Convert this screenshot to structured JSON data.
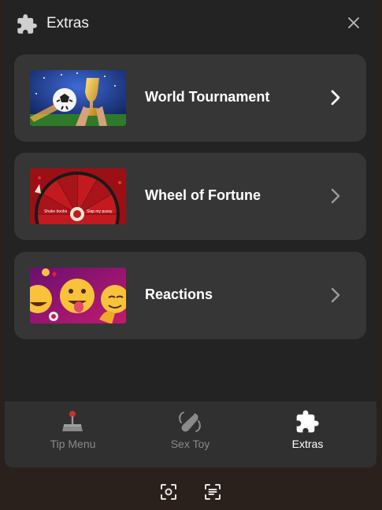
{
  "header": {
    "title": "Extras",
    "icon": "puzzle-icon",
    "close_icon": "close-icon"
  },
  "cards": [
    {
      "label": "World Tournament",
      "image": "soccer-trophy-thumbnail"
    },
    {
      "label": "Wheel of Fortune",
      "image": "prize-wheel-thumbnail",
      "wheel_text": [
        "Shake boobs",
        "Slap my pussy"
      ]
    },
    {
      "label": "Reactions",
      "image": "emoji-reactions-thumbnail"
    }
  ],
  "tabs": [
    {
      "label": "Tip Menu",
      "icon": "joystick-icon",
      "active": false
    },
    {
      "label": "Sex Toy",
      "icon": "vibrator-icon",
      "active": false
    },
    {
      "label": "Extras",
      "icon": "puzzle-icon",
      "active": true
    }
  ],
  "footer": {
    "left_icon": "screenshot-icon",
    "right_icon": "document-icon"
  },
  "colors": {
    "panel": "#232323",
    "card": "#363636",
    "bottom_bar": "#303030",
    "inactive_label": "#8a8a8a"
  }
}
